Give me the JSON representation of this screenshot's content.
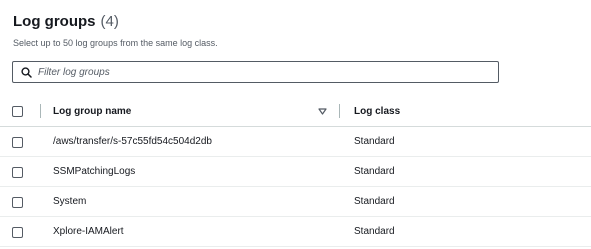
{
  "header": {
    "title": "Log groups",
    "count": "(4)",
    "subtitle": "Select up to 50 log groups from the same log class."
  },
  "search": {
    "placeholder": "Filter log groups",
    "icon": "search-icon"
  },
  "table": {
    "columns": [
      "Log group name",
      "Log class"
    ],
    "sort_icon": "caret-down-icon",
    "rows": [
      {
        "name": "/aws/transfer/s-57c55fd54c504d2db",
        "log_class": "Standard"
      },
      {
        "name": "SSMPatchingLogs",
        "log_class": "Standard"
      },
      {
        "name": "System",
        "log_class": "Standard"
      },
      {
        "name": "Xplore-IAMAlert",
        "log_class": "Standard"
      }
    ]
  }
}
